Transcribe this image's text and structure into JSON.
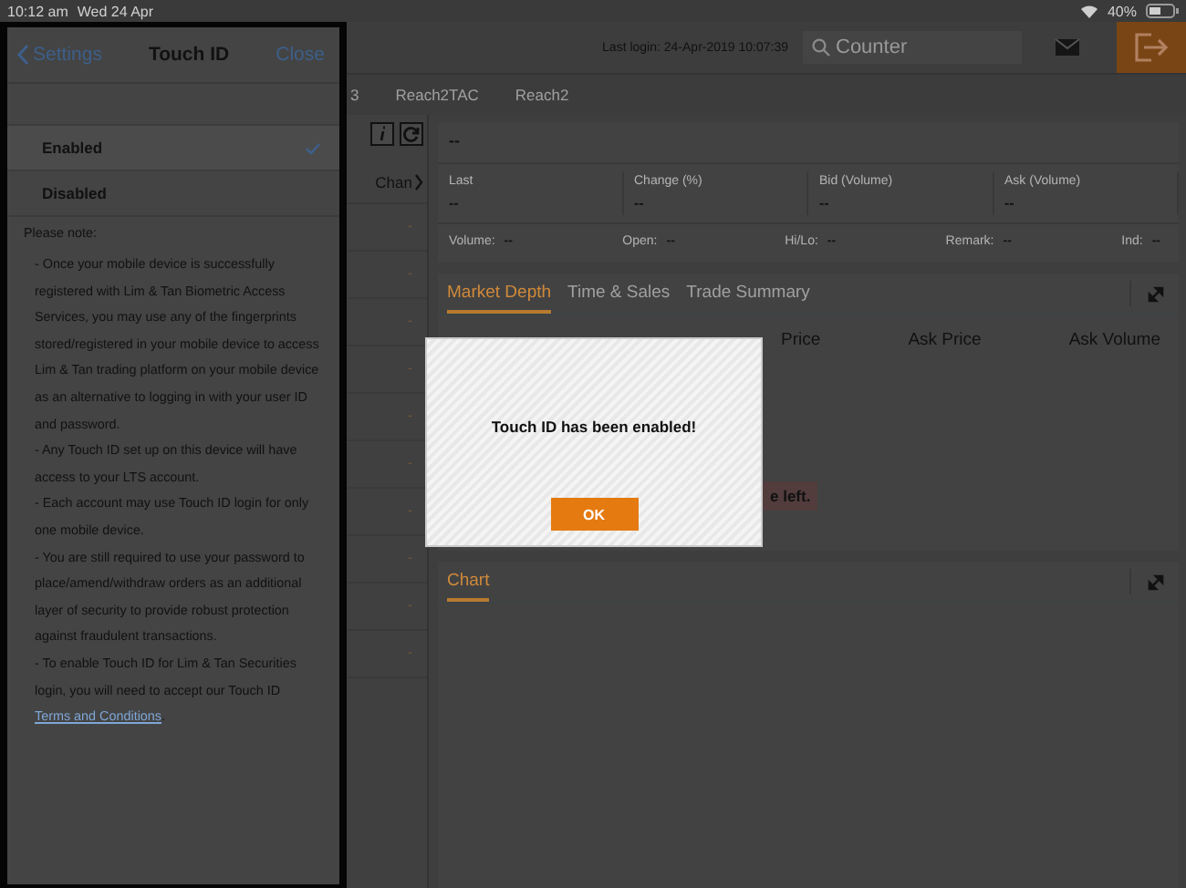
{
  "status_bar": {
    "time": "10:12 am",
    "date": "Wed 24 Apr",
    "battery_text": "40%"
  },
  "settings_panel": {
    "back": "Settings",
    "title": "Touch ID",
    "close": "Close",
    "options": [
      {
        "label": "Enabled",
        "selected": true
      },
      {
        "label": "Disabled",
        "selected": false
      }
    ],
    "note_heading": "Please note:",
    "notes": [
      {
        "text": "- Once your mobile device is successfully registered with Lim & Tan Biometric Access Services, you may use any of the fingerprints stored/registered in your mobile device to access Lim & Tan trading platform on your mobile device as an alternative to logging in with your user ID and password."
      },
      {
        "text": "- Any Touch ID set up on this device will have access to your LTS account."
      },
      {
        "text": "- Each account may use Touch ID login for only one mobile device."
      },
      {
        "text": "- You are still required to use your password to place/amend/withdraw orders as an additional layer of security to provide robust protection against fraudulent transactions."
      },
      {
        "text": "- To enable Touch ID for Lim & Tan Securities login, you will need to accept our Touch ID ",
        "link": "Terms and Conditions",
        "after": "."
      }
    ]
  },
  "header": {
    "last_login": "Last login: 24-Apr-2019 10:07:39",
    "search": {
      "placeholder": "Counter"
    }
  },
  "tabs": [
    {
      "label": "3"
    },
    {
      "label": "Reach2TAC"
    },
    {
      "label": "Reach2"
    }
  ],
  "list": {
    "column": "Chan",
    "rows": [
      "-",
      "-",
      "-",
      "-",
      "-",
      "-",
      "-",
      "-",
      "-",
      "-"
    ]
  },
  "quote": {
    "title": "--",
    "fields": [
      {
        "label": "Last",
        "value": "--"
      },
      {
        "label": "Change (%)",
        "value": "--"
      },
      {
        "label": "Bid (Volume)",
        "value": "--"
      },
      {
        "label": "Ask (Volume)",
        "value": "--"
      }
    ],
    "details": [
      {
        "label": "Volume:",
        "value": "--"
      },
      {
        "label": "Open:",
        "value": "--"
      },
      {
        "label": "Hi/Lo:",
        "value": "--"
      },
      {
        "label": "Remark:",
        "value": "--"
      },
      {
        "label": "Ind:",
        "value": "--"
      }
    ]
  },
  "depth": {
    "tabs": [
      {
        "label": "Market Depth",
        "selected": true
      },
      {
        "label": "Time & Sales",
        "selected": false
      },
      {
        "label": "Trade Summary",
        "selected": false
      }
    ],
    "columns": [
      "Price",
      "Ask Price",
      "Ask Volume"
    ],
    "message": "e left."
  },
  "chart_panel": {
    "tabs": [
      {
        "label": "Chart",
        "selected": true
      }
    ]
  },
  "dialog": {
    "message": "Touch ID has been enabled!",
    "button": "OK"
  }
}
